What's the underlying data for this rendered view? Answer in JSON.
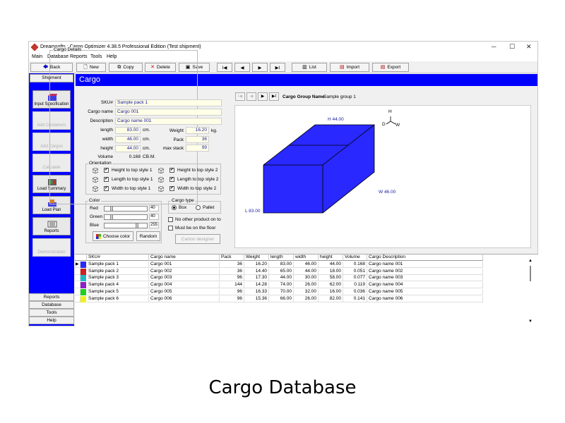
{
  "window": {
    "title": "Dreamsofts : Cargo Optimizer 4.38.5 Professional Edition  (Test shipment)",
    "controls": [
      "─",
      "☐",
      "✕"
    ]
  },
  "menu": [
    "Main",
    "Database",
    "Reports",
    "Tools",
    "Help"
  ],
  "toolbar": {
    "back": "Back",
    "new": "New",
    "copy": "Copy",
    "delete": "Delete",
    "save": "Save",
    "first": "I◀",
    "prev": "◀",
    "next": "▶",
    "last": "▶I",
    "list": "List",
    "import": "Import",
    "export": "Export"
  },
  "sidebar": {
    "tab": "Shipment",
    "buttons": [
      {
        "label": "Input Specification",
        "enabled": true
      },
      {
        "label": "Add Containers",
        "enabled": false
      },
      {
        "label": "Add Cargos",
        "enabled": false
      },
      {
        "label": "Calculate",
        "enabled": false
      },
      {
        "label": "Load Summary",
        "enabled": true
      },
      {
        "label": "Load Plan",
        "enabled": true
      },
      {
        "label": "Reports",
        "enabled": true
      },
      {
        "label": "Demonstration",
        "enabled": false
      }
    ],
    "footer": [
      "Reports",
      "Database",
      "Tools",
      "Help"
    ]
  },
  "header": {
    "title": "Cargo"
  },
  "details": {
    "legend": "Cargo Details",
    "sku_label": "SKU#",
    "sku": "Sample pack 1",
    "name_label": "Cargo name",
    "name": "Cargo 001",
    "desc_label": "Description",
    "desc": "Cargo name 001",
    "length_label": "length",
    "length": "83.00",
    "width_label": "width",
    "width": "46.00",
    "height_label": "height",
    "height": "44.00",
    "volume_label": "Volume",
    "volume": "0.168",
    "unit_cm": "cm.",
    "unit_cbm": "CB.M.",
    "unit_kg": "kg.",
    "weight_label": "Weight",
    "weight": "16.20",
    "pack_label": "Pack",
    "pack": "36",
    "maxstack_label": "max stack",
    "maxstack": "99"
  },
  "orientation": {
    "legend": "Orientation",
    "items": [
      {
        "label": "Height to top style 1",
        "checked": "✔"
      },
      {
        "label": "Height to top style 2",
        "checked": "✔"
      },
      {
        "label": "Length to top style 1",
        "checked": "✔"
      },
      {
        "label": "Length to top style 2",
        "checked": "✔"
      },
      {
        "label": "Width to top style 1",
        "checked": "✔"
      },
      {
        "label": "Width to top style 2",
        "checked": "✔"
      }
    ]
  },
  "color": {
    "legend": "Color",
    "red_label": "Red",
    "red": "40",
    "green_label": "Green",
    "green": "40",
    "blue_label": "Blue",
    "blue": "255",
    "choose": "Choose color",
    "random": "Random"
  },
  "cargotype": {
    "legend": "Cargo type",
    "box": "Box",
    "pallet": "Pallet",
    "no_other": "No other product on to",
    "floor": "Must be on the floor",
    "designer": "Carton designer"
  },
  "group": {
    "label": "Cargo Group Name",
    "value": "Sample group 1"
  },
  "view3d": {
    "box_color": "#2828ff",
    "height_label": "H 44.00",
    "width_label": "W 46.00",
    "length_label": "L 83.00",
    "axis_h": "H",
    "axis_d": "D",
    "axis_w": "W"
  },
  "grid": {
    "headers": [
      "SKU#",
      "Cargo name",
      "Pack",
      "Weight",
      "length",
      "width",
      "height",
      "Volume",
      "Cargo Description"
    ],
    "rows": [
      {
        "color": "#2828ff",
        "sku": "Sample pack 1",
        "name": "Cargo 001",
        "pack": "36",
        "weight": "16.20",
        "length": "83.00",
        "width": "46.00",
        "height": "44.00",
        "volume": "0.168",
        "desc": "Cargo name 001"
      },
      {
        "color": "#d02020",
        "sku": "Sample pack 2",
        "name": "Cargo 002",
        "pack": "36",
        "weight": "14.40",
        "length": "65.00",
        "width": "44.00",
        "height": "18.00",
        "volume": "0.051",
        "desc": "Cargo name 002"
      },
      {
        "color": "#20b8c8",
        "sku": "Sample pack 3",
        "name": "Cargo 003",
        "pack": "96",
        "weight": "17.30",
        "length": "44.00",
        "width": "30.00",
        "height": "58.00",
        "volume": "0.077",
        "desc": "Cargo name 003"
      },
      {
        "color": "#9020c8",
        "sku": "Sample pack 4",
        "name": "Cargo 004",
        "pack": "144",
        "weight": "14.28",
        "length": "74.00",
        "width": "26.00",
        "height": "62.00",
        "volume": "0.119",
        "desc": "Cargo name 004"
      },
      {
        "color": "#20d020",
        "sku": "Sample pack 5",
        "name": "Cargo 005",
        "pack": "96",
        "weight": "16.33",
        "length": "70.00",
        "width": "32.00",
        "height": "16.00",
        "volume": "0.036",
        "desc": "Cargo name 005"
      },
      {
        "color": "#f0f020",
        "sku": "Sample pack 6",
        "name": "Cargo 006",
        "pack": "96",
        "weight": "15.36",
        "length": "66.00",
        "width": "26.00",
        "height": "82.00",
        "volume": "0.141",
        "desc": "Cargo name 006"
      }
    ]
  },
  "caption": "Cargo Database"
}
